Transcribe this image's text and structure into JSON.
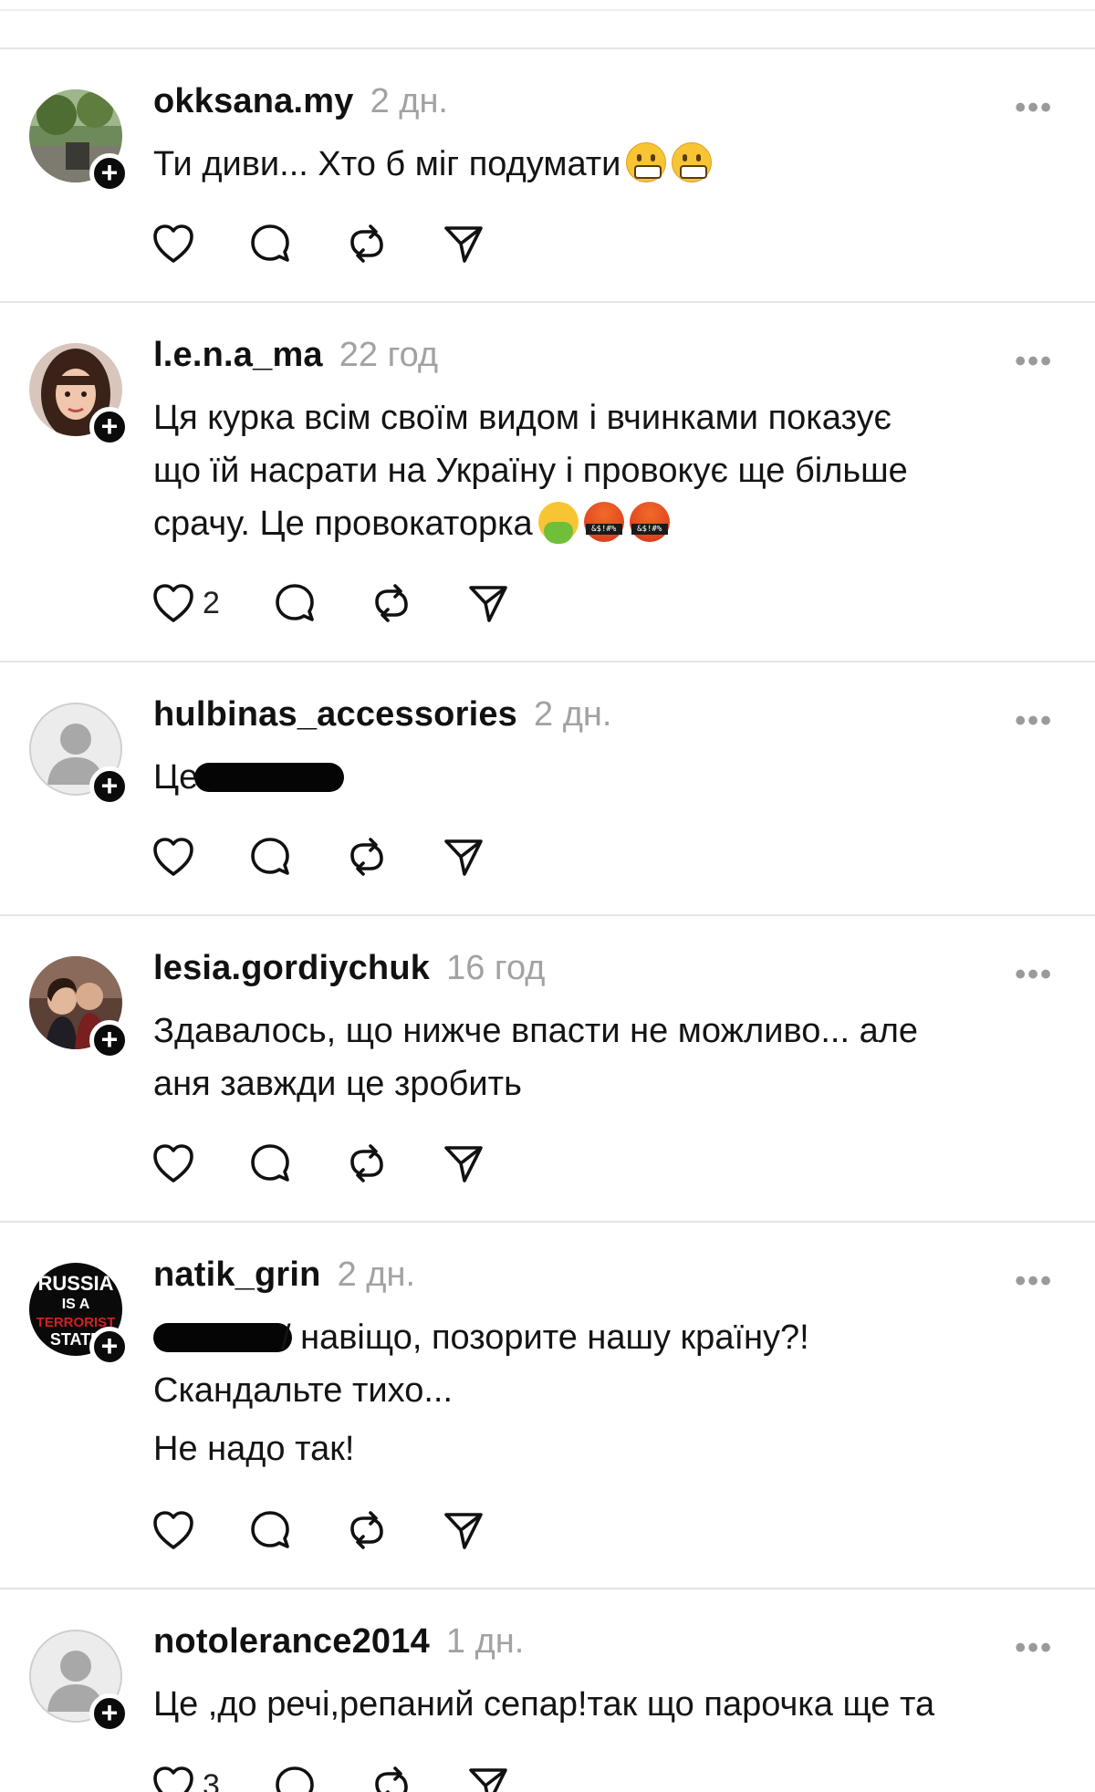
{
  "posts": [
    {
      "username": "okksana.my",
      "time": "2 дн.",
      "lines": [
        {
          "text": "Ти диви... Хто б міг подумати",
          "emojis": [
            "grimacing-face-emoji",
            "grimacing-face-emoji"
          ]
        }
      ],
      "likes": ""
    },
    {
      "username": "l.e.n.a_ma",
      "time": "22 год",
      "lines": [
        {
          "text": "Ця курка всім своїм видом і вчинками показує"
        },
        {
          "text": "що їй насрати на Україну і провокує ще більше"
        },
        {
          "text": "срачу. Це провокаторка",
          "emojis": [
            "vomiting-face-emoji",
            "cursing-face-emoji",
            "cursing-face-emoji"
          ]
        }
      ],
      "likes": "2"
    },
    {
      "username": "hulbinas_accessories",
      "time": "2 дн.",
      "lines": [
        {
          "text": "Це",
          "redaction_after": true
        }
      ],
      "likes": ""
    },
    {
      "username": "lesia.gordiychuk",
      "time": "16 год",
      "lines": [
        {
          "text": "Здавалось, що нижче впасти не можливо... але"
        },
        {
          "text": "аня завжди це зробить"
        }
      ],
      "likes": ""
    },
    {
      "username": "natik_grin",
      "time": "2 дн.",
      "avatar_text": [
        "RUSSIA",
        "IS A",
        "TERRORIST",
        "STATE"
      ],
      "lines": [
        {
          "text": "/ навіщо, позорите нашу країну?!",
          "redaction_before": true
        },
        {
          "text": "Скандальте тихо..."
        },
        {
          "text": "Не надо так!"
        }
      ],
      "likes": ""
    },
    {
      "username": "notolerance2014",
      "time": "1 дн.",
      "lines": [
        {
          "text": "Це ,до речі,репаний сепар!так що парочка ще та"
        }
      ],
      "likes": "3"
    }
  ],
  "icons": {
    "more": "more-options-icon",
    "like": "heart-icon",
    "reply": "comment-bubble-icon",
    "repost": "repost-icon",
    "share": "send-icon",
    "follow": "plus-icon"
  },
  "glyphs": {
    "more": "•••",
    "follow": "+"
  },
  "colors": {
    "text": "#141414",
    "muted": "#a2a2a2",
    "divider": "#e4e4e4",
    "badge": "#0b0b0b"
  }
}
